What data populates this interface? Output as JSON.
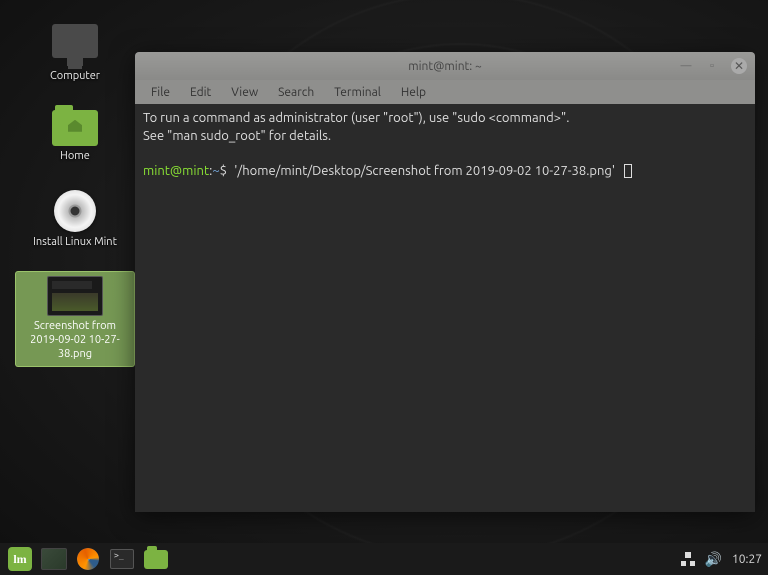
{
  "desktop": {
    "icons": [
      {
        "id": "computer",
        "label": "Computer"
      },
      {
        "id": "home",
        "label": "Home"
      },
      {
        "id": "install",
        "label": "Install Linux Mint"
      },
      {
        "id": "screenshot",
        "label": "Screenshot from 2019-09-02 10-27-38.png",
        "selected": true
      }
    ]
  },
  "terminal": {
    "title": "mint@mint: ~",
    "menu": [
      "File",
      "Edit",
      "View",
      "Search",
      "Terminal",
      "Help"
    ],
    "motd_line1": "To run a command as administrator (user \"root\"), use \"sudo <command>\".",
    "motd_line2": "See \"man sudo_root\" for details.",
    "prompt_user": "mint@mint",
    "prompt_sep": ":",
    "prompt_path": "~",
    "prompt_sym": "$",
    "command": "'/home/mint/Desktop/Screenshot from 2019-09-02 10-27-38.png'"
  },
  "panel": {
    "clock": "10:27"
  }
}
